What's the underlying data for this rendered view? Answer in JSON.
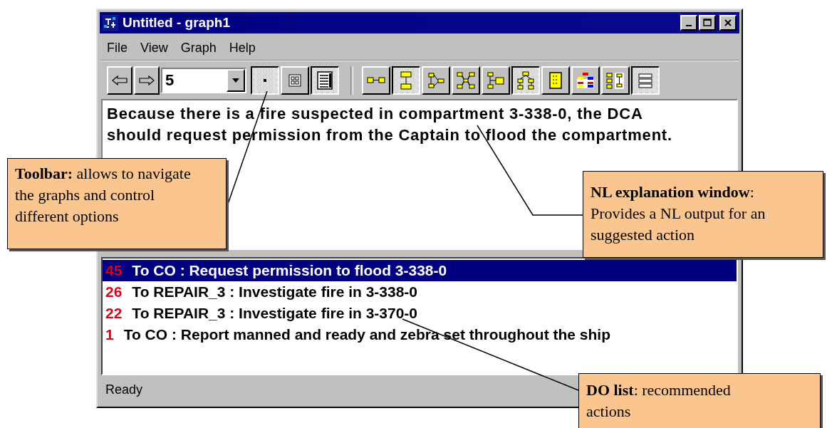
{
  "window": {
    "title": "Untitled - graph1"
  },
  "menu": [
    "File",
    "View",
    "Graph",
    "Help"
  ],
  "toolbar": {
    "combo_value": "5",
    "view_buttons": [
      {
        "pressed": true
      },
      {
        "pressed": false
      },
      {
        "pressed": true
      }
    ],
    "graph_buttons": [
      {
        "pressed": false
      },
      {
        "pressed": true
      },
      {
        "pressed": false
      },
      {
        "pressed": false
      },
      {
        "pressed": false
      },
      {
        "pressed": true
      },
      {
        "pressed": false
      },
      {
        "pressed": false
      },
      {
        "pressed": false
      },
      {
        "pressed": true
      }
    ]
  },
  "explanation": "Because there is a fire suspected in compartment 3-338-0, the DCA should request permission from the Captain to flood the compartment.",
  "do_list": [
    {
      "priority": "45",
      "text": "To CO : Request permission to flood 3-338-0",
      "selected": true
    },
    {
      "priority": "26",
      "text": "To REPAIR_3 : Investigate fire in 3-338-0",
      "selected": false
    },
    {
      "priority": "22",
      "text": "To REPAIR_3 : Investigate fire in 3-370-0",
      "selected": false
    },
    {
      "priority": "1",
      "text": "To CO : Report manned and ready and zebra set throughout the ship",
      "selected": false
    }
  ],
  "status_bar": "Ready",
  "callouts": [
    {
      "kind": "toolbar",
      "text": "**Toolbar:** allows to navigate the graphs and control different options"
    },
    {
      "kind": "explanation",
      "text": "**NL explanation window**: Provides a NL output for an suggested action"
    },
    {
      "kind": "list",
      "text": "**DO list**: recommended actions"
    }
  ]
}
